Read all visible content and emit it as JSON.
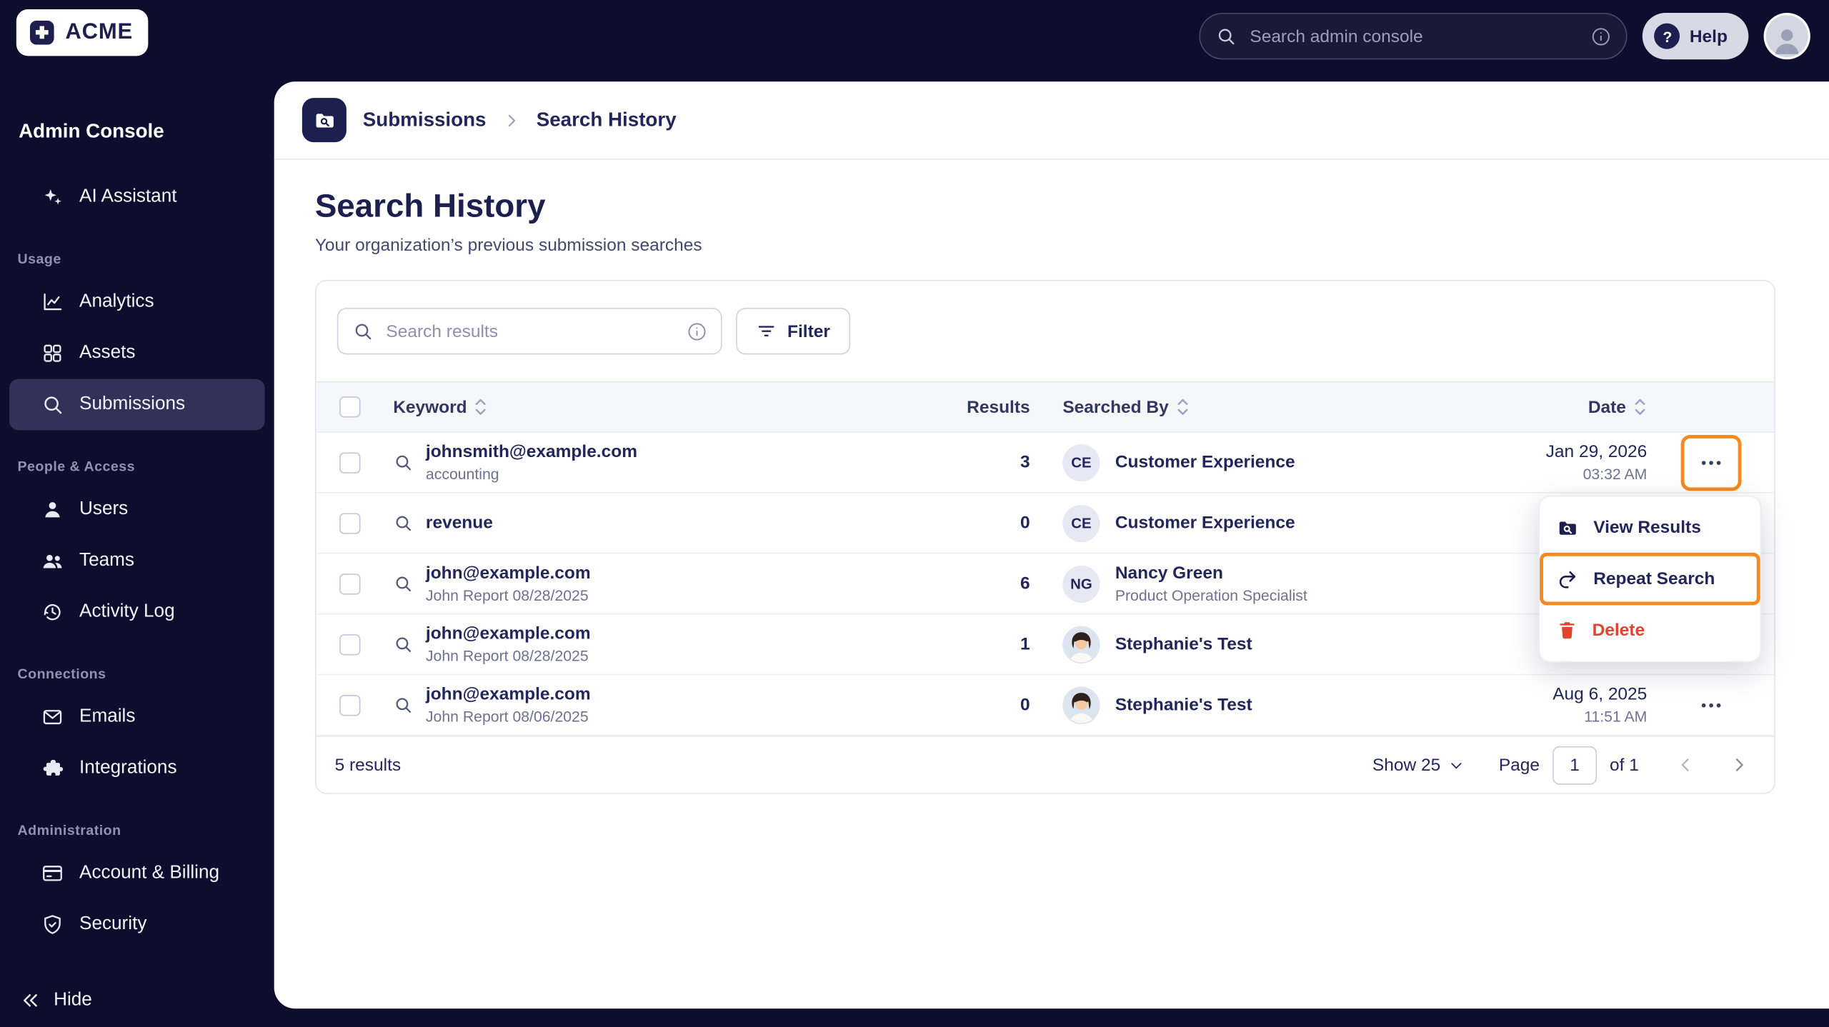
{
  "topbar": {
    "logo_text": "ACME",
    "search_placeholder": "Search admin console",
    "search_icon": "search-icon",
    "info_icon": "info-icon",
    "help_label": "Help",
    "help_icon": "question-circle-icon",
    "avatar_icon": "person-icon"
  },
  "sidebar": {
    "title": "Admin Console",
    "assistant": {
      "label": "AI Assistant",
      "icon": "sparkles-icon"
    },
    "sections": [
      {
        "label": "Usage",
        "items": [
          {
            "label": "Analytics",
            "icon": "analytics-icon",
            "active": false
          },
          {
            "label": "Assets",
            "icon": "assets-icon",
            "active": false
          },
          {
            "label": "Submissions",
            "icon": "magnifier-icon",
            "active": true
          }
        ]
      },
      {
        "label": "People & Access",
        "items": [
          {
            "label": "Users",
            "icon": "user-icon",
            "active": false
          },
          {
            "label": "Teams",
            "icon": "teams-icon",
            "active": false
          },
          {
            "label": "Activity Log",
            "icon": "history-clock-icon",
            "active": false
          }
        ]
      },
      {
        "label": "Connections",
        "items": [
          {
            "label": "Emails",
            "icon": "envelope-icon",
            "active": false
          },
          {
            "label": "Integrations",
            "icon": "puzzle-icon",
            "active": false
          }
        ]
      },
      {
        "label": "Administration",
        "items": [
          {
            "label": "Account & Billing",
            "icon": "credit-card-icon",
            "active": false
          },
          {
            "label": "Security",
            "icon": "shield-check-icon",
            "active": false
          }
        ]
      }
    ],
    "hide_label": "Hide",
    "hide_icon": "double-chevron-left-icon"
  },
  "breadcrumb": {
    "icon": "folder-search-icon",
    "root": "Submissions",
    "current": "Search History"
  },
  "page": {
    "title": "Search History",
    "subtitle": "Your organization’s previous submission searches"
  },
  "toolbar": {
    "search_placeholder": "Search results",
    "filter_label": "Filter",
    "filter_icon": "filter-lines-icon"
  },
  "table": {
    "headers": {
      "keyword": "Keyword",
      "results": "Results",
      "searched_by": "Searched By",
      "date": "Date"
    },
    "rows": [
      {
        "keyword": "johnsmith@example.com",
        "sub": "accounting",
        "results": "3",
        "avatar_initials": "CE",
        "searcher": "Customer Experience",
        "searcher_sub": "",
        "date": "Jan 29, 2026",
        "time": "03:32 AM"
      },
      {
        "keyword": "revenue",
        "sub": "",
        "results": "0",
        "avatar_initials": "CE",
        "searcher": "Customer Experience",
        "searcher_sub": "",
        "date": "",
        "time": ""
      },
      {
        "keyword": "john@example.com",
        "sub": "John Report 08/28/2025",
        "results": "6",
        "avatar_initials": "NG",
        "searcher": "Nancy Green",
        "searcher_sub": "Product Operation Specialist",
        "date": "",
        "time": ""
      },
      {
        "keyword": "john@example.com",
        "sub": "John Report 08/28/2025",
        "results": "1",
        "avatar_initials": "",
        "searcher": "Stephanie's Test",
        "searcher_sub": "",
        "date": "",
        "time": ""
      },
      {
        "keyword": "john@example.com",
        "sub": "John Report 08/06/2025",
        "results": "0",
        "avatar_initials": "",
        "searcher": "Stephanie's Test",
        "searcher_sub": "",
        "date": "Aug 6, 2025",
        "time": "11:51 AM"
      }
    ]
  },
  "menu": {
    "items": [
      {
        "label": "View Results",
        "icon": "folder-search-icon"
      },
      {
        "label": "Repeat Search",
        "icon": "repeat-arrow-icon"
      },
      {
        "label": "Delete",
        "icon": "trash-icon"
      }
    ]
  },
  "footer": {
    "results_text": "5 results",
    "show_label": "Show 25",
    "page_label": "Page",
    "page_value": "1",
    "of_label": "of 1"
  },
  "colors": {
    "annotation_orange": "#F6891F",
    "danger_red": "#E0452E",
    "brand_navy": "#1D1F4E",
    "sidebar_bg": "#0D0E2E",
    "active_item_bg": "#313257",
    "table_header_bg": "#F6F7FB"
  }
}
